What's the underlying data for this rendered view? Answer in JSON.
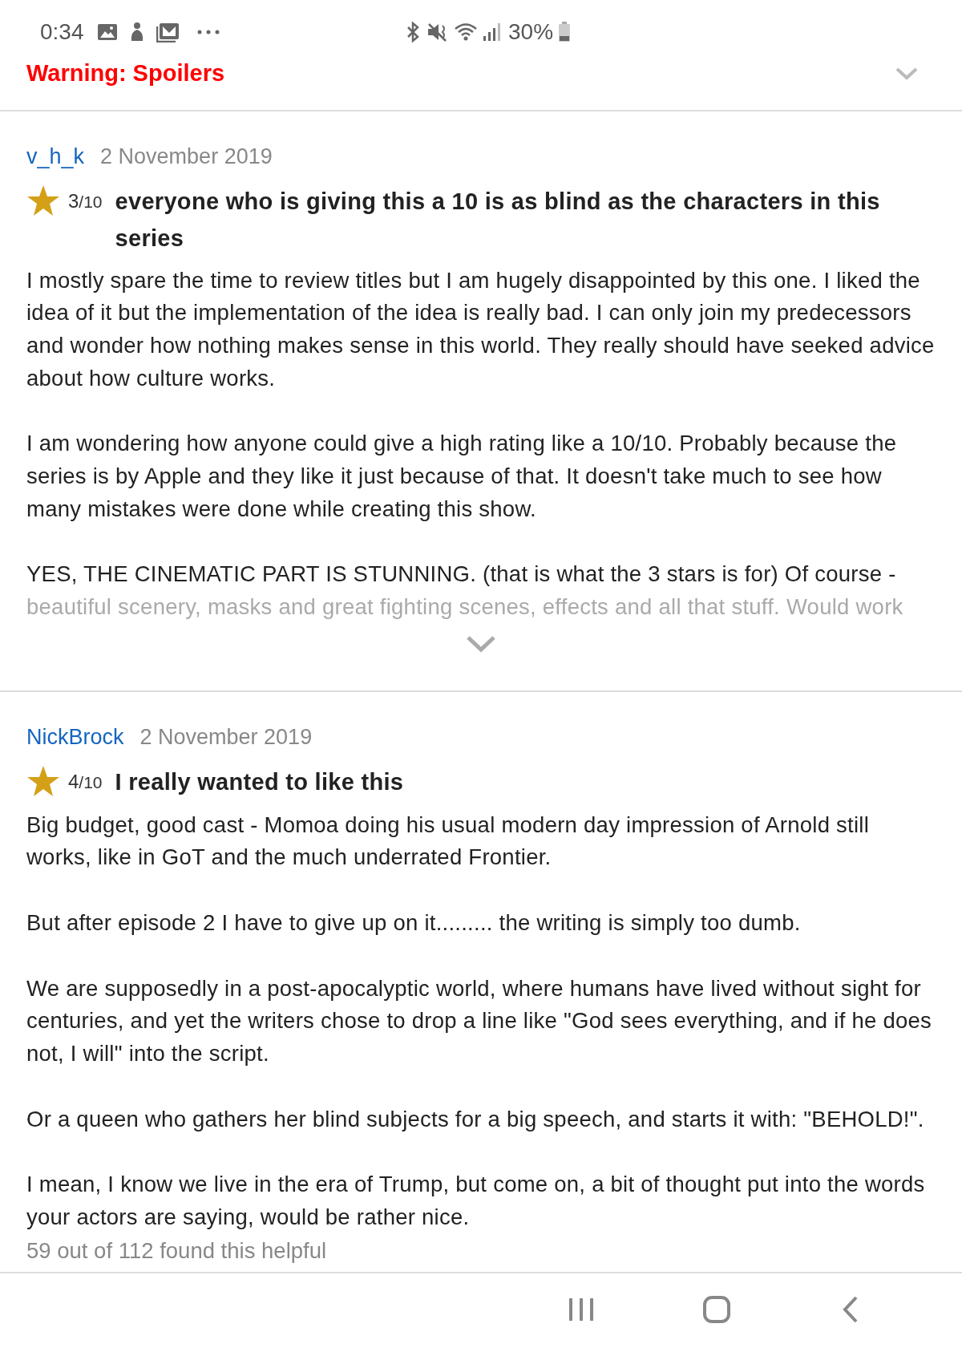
{
  "status_bar": {
    "time": "0:34",
    "battery": "30%"
  },
  "spoiler_banner": {
    "label": "Warning: Spoilers"
  },
  "reviews": [
    {
      "author": "v_h_k",
      "date": "2 November 2019",
      "rating": "3",
      "rating_max": "/10",
      "title": "everyone who is giving this a 10 is as blind as the characters in this series",
      "collapsed": true,
      "paragraphs": [
        "I mostly spare the time to review titles but I am hugely disappointed by this one. I liked the idea of it but the implementation of the idea is really bad. I can only join my predecessors and wonder how nothing makes sense in this world. They really should have seeked advice about how culture works.",
        "I am wondering how anyone could give a high rating like a 10/10. Probably because the series is by Apple and they like it just because of that. It doesn't take much to see how many mistakes were done while creating this show.",
        "YES, THE CINEMATIC PART IS STUNNING. (that is what the 3 stars is for) Of course -"
      ],
      "faded_line": "beautiful scenery, masks and great fighting scenes, effects and all that stuff. Would work"
    },
    {
      "author": "NickBrock",
      "date": "2 November 2019",
      "rating": "4",
      "rating_max": "/10",
      "title": "I really wanted to like this",
      "collapsed": false,
      "paragraphs": [
        "Big budget, good cast - Momoa doing his usual modern day impression of Arnold still works, like in GoT and the much underrated Frontier.",
        "But after episode 2 I have to give up on it......... the writing is simply too dumb.",
        "We are supposedly in a post-apocalyptic world, where humans have lived without sight for centuries, and yet the writers chose to drop a line like \"God sees everything, and if he does not, I will\" into the script.",
        "Or a queen who gathers her blind subjects for a big speech, and starts it with: \"BEHOLD!\".",
        "I mean, I know we live in the era of Trump, but come on, a bit of thought put into the words your actors are saying, would be rather nice."
      ],
      "helpful": "59 out of 112 found this helpful"
    }
  ]
}
